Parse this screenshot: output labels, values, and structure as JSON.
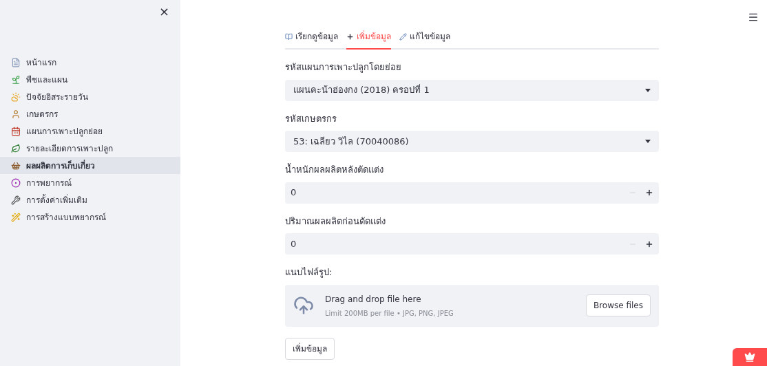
{
  "sidebar": {
    "close": "×",
    "items": [
      {
        "label": "หน้าแรก",
        "selected": false
      },
      {
        "label": "พืชและแผน",
        "selected": false
      },
      {
        "label": "ปัจจัยอิสระรายวัน",
        "selected": false
      },
      {
        "label": "เกษตรกร",
        "selected": false
      },
      {
        "label": "แผนการเพาะปลูกย่อย",
        "selected": false
      },
      {
        "label": "รายละเอียดการเพาะปลูก",
        "selected": false
      },
      {
        "label": "ผลผลิตการเก็บเกี่ยว",
        "selected": true
      },
      {
        "label": "การพยากรณ์",
        "selected": false
      },
      {
        "label": "การตั้งค่าเพิ่มเติม",
        "selected": false
      },
      {
        "label": "การสร้างแบบพยากรณ์",
        "selected": false
      }
    ]
  },
  "tabs": [
    {
      "label": "เรียกดูข้อมูล",
      "selected": false
    },
    {
      "label": "เพิ่มข้อมูล",
      "selected": true
    },
    {
      "label": "แก้ไขข้อมูล",
      "selected": false
    }
  ],
  "fields": [
    {
      "kind": "select",
      "label": "รหัสแผนการเพาะปลูกโดยย่อย",
      "value": "แผนคะน้าฮ่องกง (2018) ครอปที่ 1"
    },
    {
      "kind": "select",
      "label": "รหัสเกษตรกร",
      "value": "53: เฉลียว วิไล (70040086)"
    },
    {
      "kind": "number",
      "label": "น้ำหนักผลผลิตหลังตัดแต่ง",
      "value": "0"
    },
    {
      "kind": "number",
      "label": "ปริมาณผลผลิตก่อนตัดแต่ง",
      "value": "0"
    },
    {
      "kind": "upload",
      "label": "แนบไฟล์รูป:",
      "title": "Drag and drop file here",
      "hint": "Limit 200MB per file • JPG, PNG, JPEG",
      "button": "Browse files"
    }
  ],
  "submit": "เพิ่มข้อมูล"
}
